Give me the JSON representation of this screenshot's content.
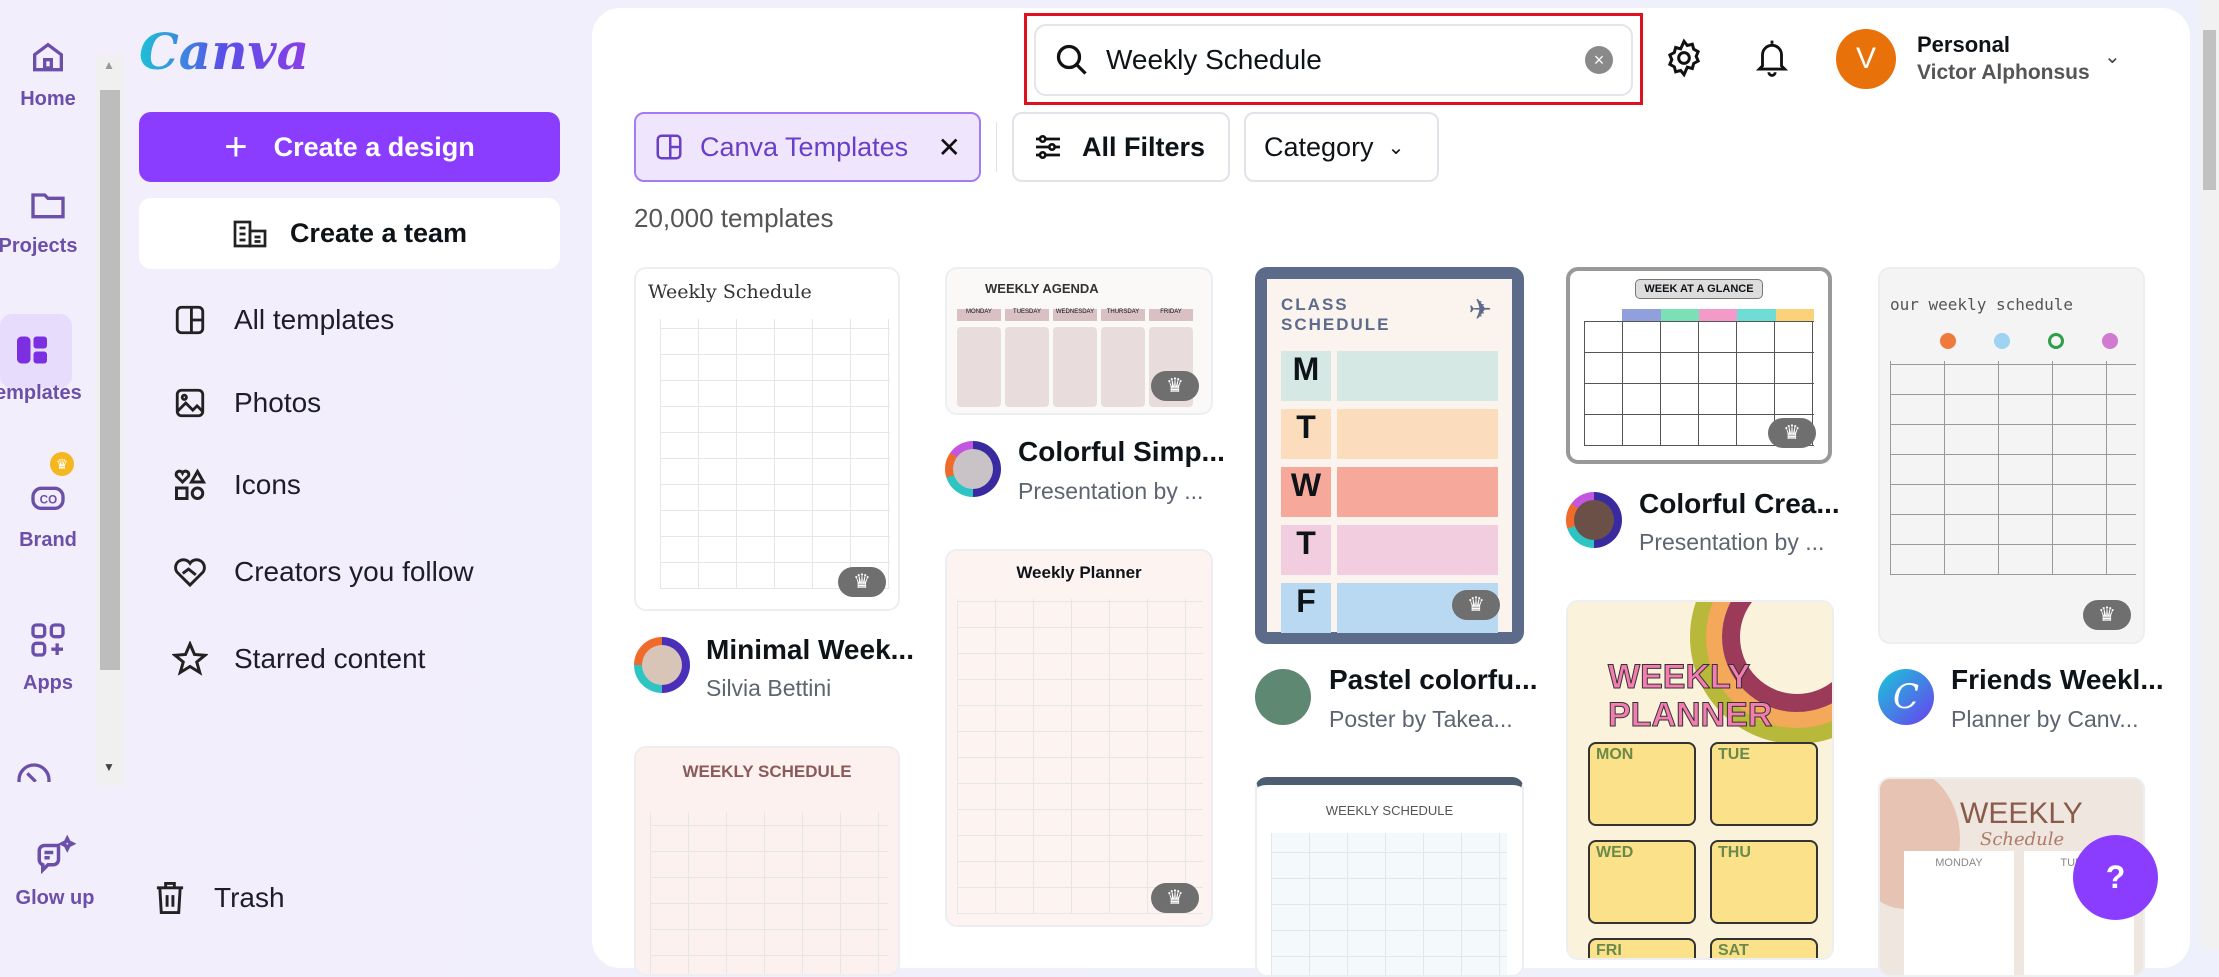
{
  "rail": {
    "items": [
      {
        "label": "Home",
        "icon": "home-icon"
      },
      {
        "label": "Projects",
        "icon": "folder-icon"
      },
      {
        "label": "Templates",
        "icon": "templates-icon",
        "active": true
      },
      {
        "label": "Brand",
        "icon": "brand-icon",
        "badge": "crown"
      },
      {
        "label": "Apps",
        "icon": "apps-icon"
      },
      {
        "label": "Glow up",
        "icon": "glow-up-icon"
      }
    ]
  },
  "panel": {
    "logo": "Canva",
    "create_design": "Create a design",
    "create_team": "Create a team",
    "items": [
      {
        "label": "All templates",
        "icon": "templates-icon"
      },
      {
        "label": "Photos",
        "icon": "image-icon"
      },
      {
        "label": "Icons",
        "icon": "shapes-icon"
      },
      {
        "label": "Creators you follow",
        "icon": "heart-icon"
      },
      {
        "label": "Starred content",
        "icon": "star-icon"
      }
    ],
    "trash": "Trash"
  },
  "header": {
    "search_value": "Weekly Schedule",
    "account_type": "Personal",
    "user_name": "Victor Alphonsus",
    "avatar_initial": "V",
    "avatar_color": "#e8710a",
    "highlight_color": "#e0101e"
  },
  "filters": {
    "active_chip": "Canva Templates",
    "all_filters": "All Filters",
    "category": "Category"
  },
  "result_count": "20,000 templates",
  "cards": [
    {
      "title": "Minimal Week...",
      "subtitle": "Silvia Bettini",
      "thumb_text": "Weekly Schedule"
    },
    {
      "title": "Colorful Simp...",
      "subtitle": "Presentation by ...",
      "thumb_text": "WEEKLY AGENDA",
      "days": [
        "MONDAY",
        "TUESDAY",
        "WEDNESDAY",
        "THURSDAY",
        "FRIDAY"
      ]
    },
    {
      "title": "Pastel colorfu...",
      "subtitle": "Poster by Takea...",
      "thumb_text": "CLASS SCHEDULE",
      "days": [
        "M",
        "T",
        "W",
        "T",
        "F"
      ]
    },
    {
      "title": "Colorful Crea...",
      "subtitle": "Presentation by ...",
      "thumb_text": "WEEK AT A GLANCE"
    },
    {
      "title": "Friends Weekl...",
      "subtitle": "Planner by Canv...",
      "thumb_text": "our weekly schedule"
    }
  ],
  "more_thumbs": {
    "col1": "WEEKLY SCHEDULE",
    "col2": "Weekly Planner",
    "col3": "WEEKLY SCHEDULE",
    "col4": "WEEKLY PLANNER",
    "col4_days": [
      "MON",
      "TUE",
      "WED",
      "THU",
      "FRI",
      "SAT"
    ],
    "col5": "WEEKLY",
    "col5_script": "Schedule",
    "col5_days": [
      "MONDAY",
      "TUESD"
    ]
  },
  "help_label": "?"
}
